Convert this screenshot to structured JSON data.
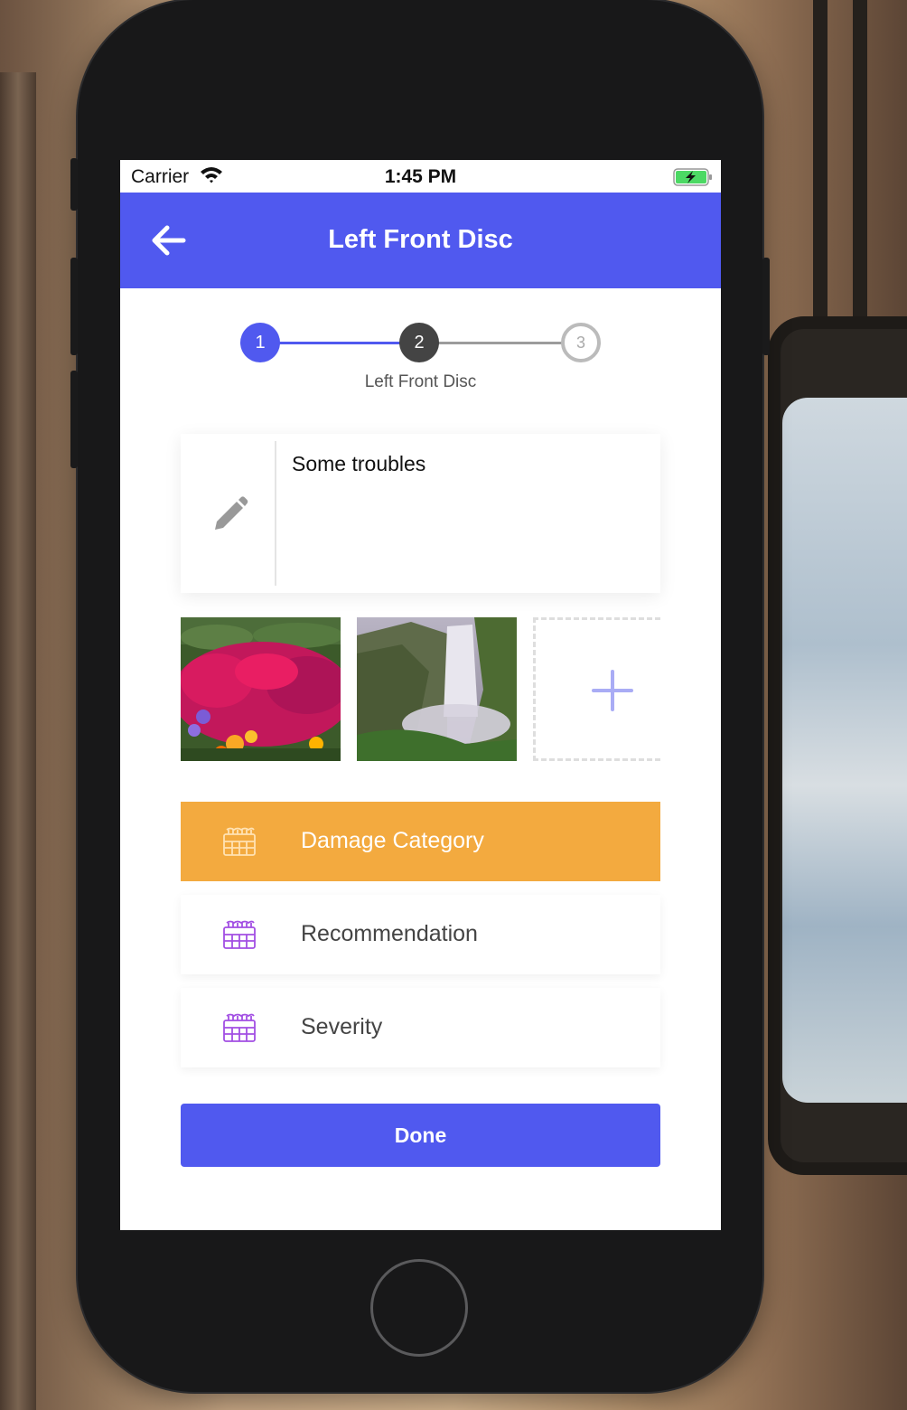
{
  "status_bar": {
    "carrier": "Carrier",
    "time": "1:45 PM",
    "wifi_icon": "wifi-icon",
    "battery_icon": "battery-charging-icon"
  },
  "header": {
    "title": "Left Front Disc",
    "back_icon": "arrow-left-icon",
    "background_color": "#5059ef"
  },
  "stepper": {
    "steps": [
      {
        "number": "1",
        "state": "completed",
        "color": "#5059ef"
      },
      {
        "number": "2",
        "state": "current",
        "color": "#444444"
      },
      {
        "number": "3",
        "state": "pending",
        "color": "#bbbbbb"
      }
    ],
    "current_label": "Left Front Disc"
  },
  "note": {
    "icon": "pencil-icon",
    "text": "Some troubles"
  },
  "photos": {
    "items": [
      "flowers-photo",
      "waterfall-photo"
    ],
    "add_icon": "plus-icon"
  },
  "options": [
    {
      "label": "Damage Category",
      "icon": "calendar-grid-icon",
      "active": true,
      "color": "#f3aa3f"
    },
    {
      "label": "Recommendation",
      "icon": "calendar-grid-icon",
      "active": false
    },
    {
      "label": "Severity",
      "icon": "calendar-grid-icon",
      "active": false
    }
  ],
  "done_button": {
    "label": "Done"
  }
}
